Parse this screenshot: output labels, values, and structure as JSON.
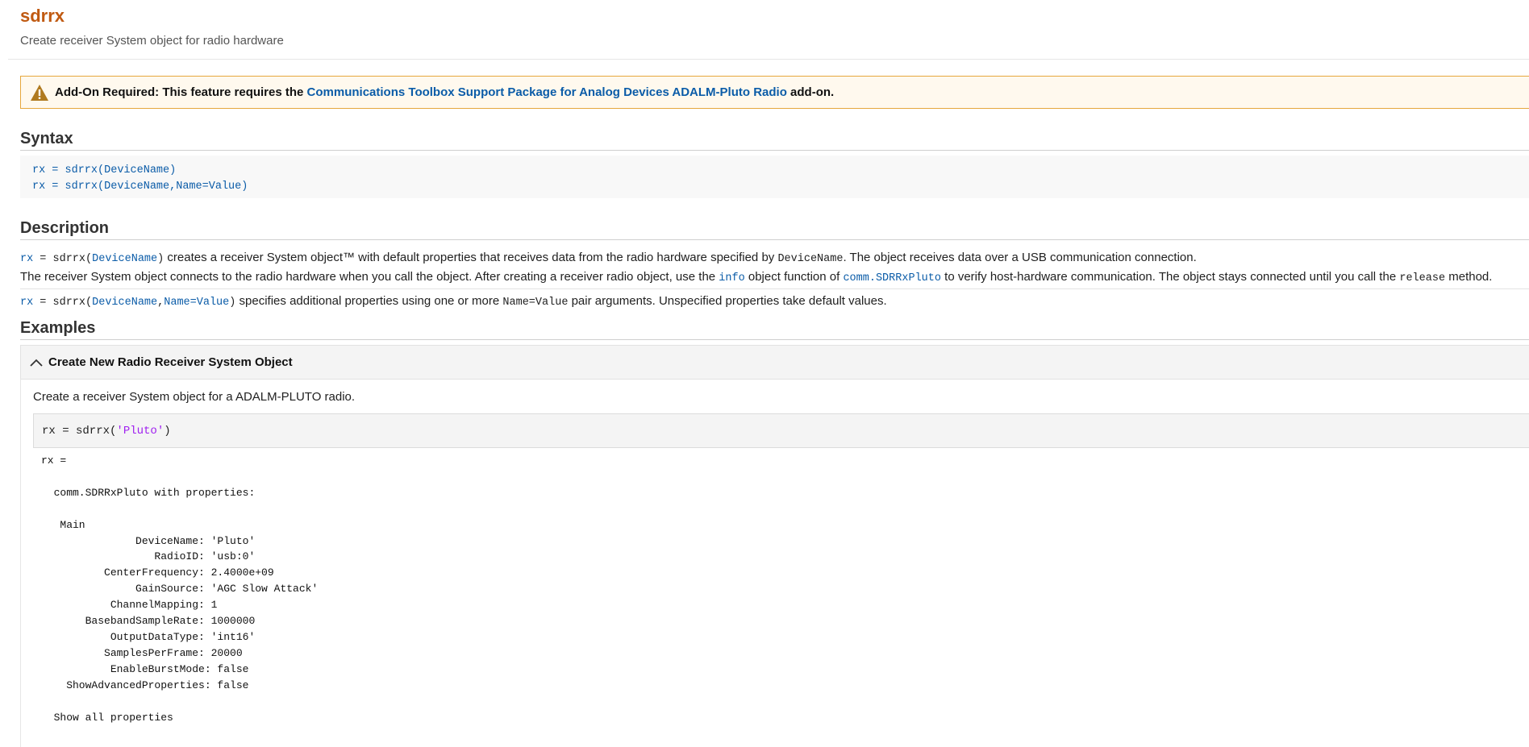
{
  "page": {
    "title": "sdrrx",
    "purpose": "Create receiver System object for radio hardware"
  },
  "addon": {
    "prefix": "Add-On Required:",
    "text": " This feature requires the ",
    "link": "Communications Toolbox Support Package for Analog Devices ADALM-Pluto Radio",
    "suffix": " add-on.",
    "icon": "warning-icon"
  },
  "syntax": {
    "heading": "Syntax",
    "lines": [
      "rx = sdrrx(DeviceName)",
      "rx = sdrrx(DeviceName,Name=Value)"
    ]
  },
  "description": {
    "heading": "Description",
    "d1_rx": "rx",
    "d1_eq": " = sdrrx(",
    "d1_arg": "DeviceName",
    "d1_close": ")",
    "d1_text": " creates a receiver System object™ with default properties that receives data from the radio hardware specified by ",
    "d1_code": "DeviceName",
    "d1_tail": ". The object receives data over a USB communication connection.",
    "d2_a": "The receiver System object connects to the radio hardware when you call the object. After creating a receiver radio object, use the ",
    "d2_info": "info",
    "d2_b": " object function of ",
    "d2_comm": "comm.SDRRxPluto",
    "d2_c": " to verify host-hardware communication. The object stays connected until you call the ",
    "d2_release": "release",
    "d2_d": " method.",
    "d3_rx": "rx",
    "d3_eq": " = sdrrx(",
    "d3_arg": "DeviceName",
    "d3_comma": ",",
    "d3_nv": "Name=Value",
    "d3_close": ")",
    "d3_text": " specifies additional properties using one or more ",
    "d3_code": "Name=Value",
    "d3_tail": " pair arguments. Unspecified properties take default values."
  },
  "examples": {
    "heading": "Examples",
    "example_title": "Create New Radio Receiver System Object",
    "intro": "Create a receiver System object for a ADALM-PLUTO radio.",
    "code_prefix": "rx = sdrrx(",
    "code_str": "'Pluto'",
    "code_suffix": ")",
    "output": "rx = \n\n  comm.SDRRxPluto with properties:\n\n   Main\n               DeviceName: 'Pluto'\n                  RadioID: 'usb:0'\n          CenterFrequency: 2.4000e+09\n               GainSource: 'AGC Slow Attack'\n           ChannelMapping: 1\n       BasebandSampleRate: 1000000\n           OutputDataType: 'int16'\n          SamplesPerFrame: 20000\n           EnableBurstMode: false\n    ShowAdvancedProperties: false\n\n  Show all properties"
  }
}
